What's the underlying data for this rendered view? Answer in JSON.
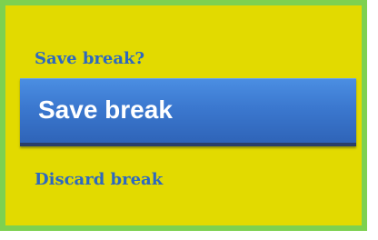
{
  "dialog": {
    "title": "Save break?",
    "save_label": "Save break",
    "discard_label": "Discard break"
  },
  "colors": {
    "frame": "#7dd150",
    "background": "#e2da00",
    "text_accent": "#2d68c0",
    "button": "#3b78cf"
  }
}
